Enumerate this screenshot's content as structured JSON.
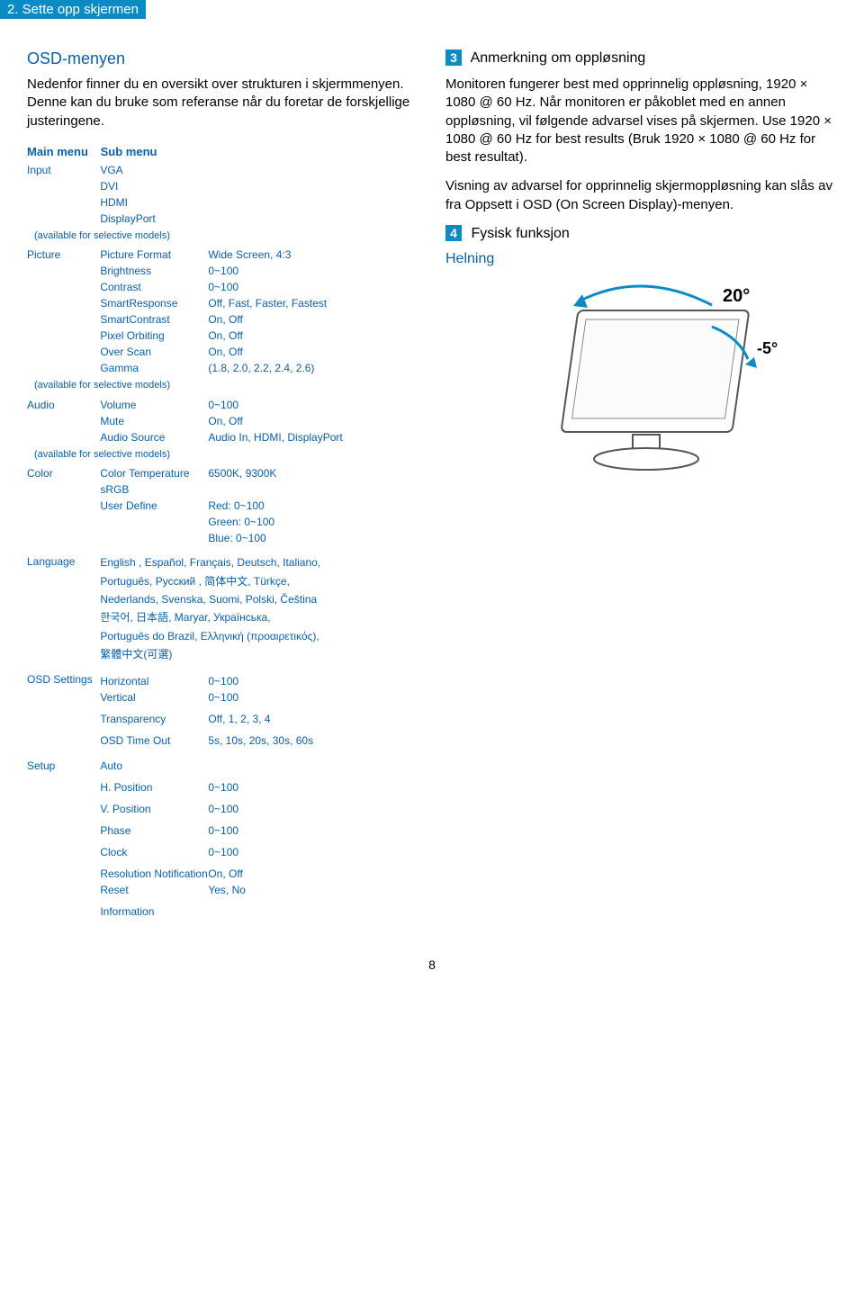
{
  "header": "2. Sette opp skjermen",
  "left": {
    "osd_title": "OSD-menyen",
    "intro": "Nedenfor finner du en oversikt over strukturen i skjermmenyen. Denne kan du bruke som referanse når du foretar de forskjellige justeringene.",
    "main_menu_label": "Main menu",
    "sub_menu_label": "Sub menu",
    "avail_note": "(available for selective models)",
    "menu": {
      "input": {
        "label": "Input",
        "items": [
          "VGA",
          "DVI",
          "HDMI",
          "DisplayPort"
        ]
      },
      "picture": {
        "label": "Picture",
        "rows": [
          {
            "s": "Picture Format",
            "v": "Wide Screen, 4:3"
          },
          {
            "s": "Brightness",
            "v": "0~100"
          },
          {
            "s": "Contrast",
            "v": "0~100"
          },
          {
            "s": "SmartResponse",
            "v": "Off, Fast, Faster, Fastest"
          },
          {
            "s": "SmartContrast",
            "v": "On, Off"
          },
          {
            "s": "Pixel Orbiting",
            "v": "On, Off"
          },
          {
            "s": "Over Scan",
            "v": "On, Off"
          },
          {
            "s": "Gamma",
            "v": "(1.8, 2.0, 2.2, 2.4, 2.6)"
          }
        ]
      },
      "audio": {
        "label": "Audio",
        "rows": [
          {
            "s": "Volume",
            "v": "0~100"
          },
          {
            "s": "Mute",
            "v": "On, Off"
          },
          {
            "s": "Audio Source",
            "v": "Audio In, HDMI, DisplayPort"
          }
        ]
      },
      "color": {
        "label": "Color",
        "rows": [
          {
            "s": "Color Temperature",
            "v": "6500K, 9300K"
          },
          {
            "s": "sRGB",
            "v": ""
          },
          {
            "s": "User Define",
            "v": "Red: 0~100"
          }
        ],
        "extra": [
          "Green: 0~100",
          "Blue: 0~100"
        ]
      },
      "language": {
        "label": "Language",
        "lines": [
          "English , Español, Français, Deutsch, Italiano,",
          "Português, Русский , 简体中文, Türkçe,",
          "Nederlands, Svenska, Suomi, Polski, Čeština",
          "한국어, 日本語, Maryar, Українська,",
          "Português do Brazil,  Ελληνική (προαιρετικός),",
          "繁體中文(可選)"
        ]
      },
      "osd": {
        "label": "OSD Settings",
        "rows": [
          {
            "s": "Horizontal",
            "v": "0~100"
          },
          {
            "s": "Vertical",
            "v": "0~100"
          },
          {
            "s": "Transparency",
            "v": "Off, 1, 2, 3, 4"
          },
          {
            "s": "OSD Time Out",
            "v": "5s, 10s, 20s, 30s, 60s"
          }
        ]
      },
      "setup": {
        "label": "Setup",
        "rows": [
          {
            "s": "Auto",
            "v": ""
          },
          {
            "s": "H. Position",
            "v": "0~100"
          },
          {
            "s": "V. Position",
            "v": "0~100"
          },
          {
            "s": "Phase",
            "v": "0~100"
          },
          {
            "s": "Clock",
            "v": "0~100"
          },
          {
            "s": "Resolution Notification",
            "v": "On, Off"
          },
          {
            "s": "Reset",
            "v": "Yes, No"
          },
          {
            "s": "Information",
            "v": ""
          }
        ]
      }
    }
  },
  "right": {
    "sec3_num": "3",
    "sec3_title": "Anmerkning om oppløsning",
    "sec3_p1": "Monitoren fungerer best med opprinnelig oppløsning, 1920 × 1080 @ 60 Hz. Når monitoren er påkoblet med en annen oppløsning, vil følgende advarsel vises på skjermen. Use 1920 × 1080 @ 60 Hz for best results (Bruk 1920 × 1080 @ 60 Hz for best resultat).",
    "sec3_p2": "Visning av advarsel for opprinnelig skjermoppløsning kan slås av fra Oppsett i OSD (On Screen Display)-menyen.",
    "sec4_num": "4",
    "sec4_title": "Fysisk funksjon",
    "helning": "Helning",
    "angle_up": "20°",
    "angle_down": "-5°"
  },
  "page_number": "8"
}
